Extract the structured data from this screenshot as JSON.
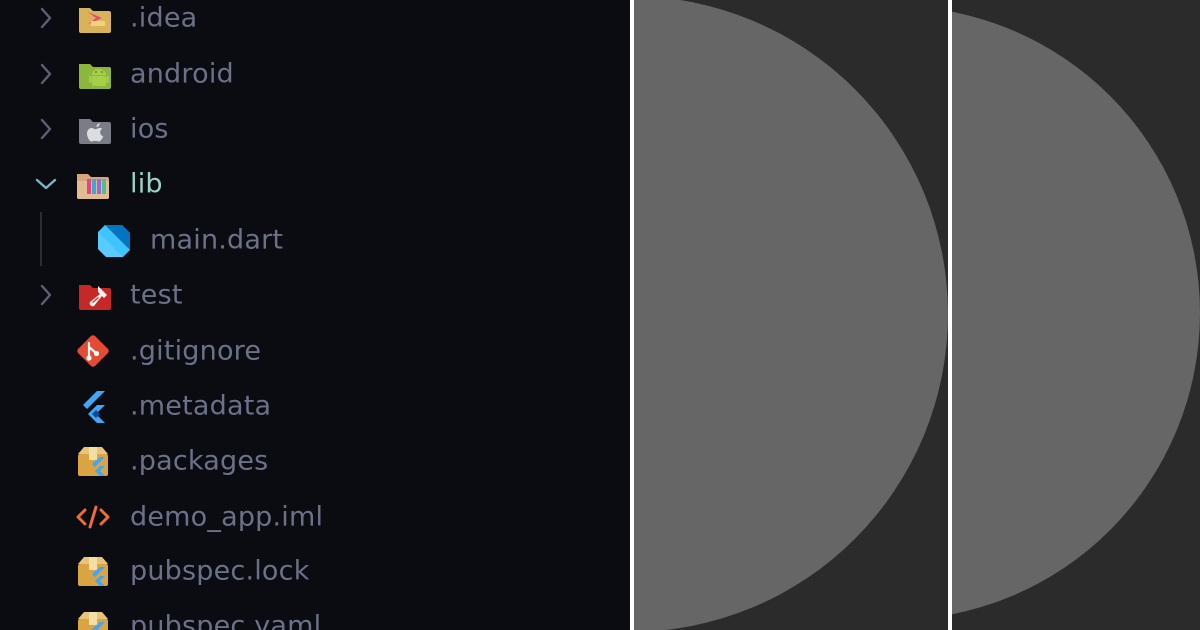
{
  "explorer": {
    "items": [
      {
        "name": ".idea",
        "type": "folder",
        "expanded": false,
        "icon": "idea-folder-icon"
      },
      {
        "name": "android",
        "type": "folder",
        "expanded": false,
        "icon": "android-folder-icon"
      },
      {
        "name": "ios",
        "type": "folder",
        "expanded": false,
        "icon": "apple-folder-icon"
      },
      {
        "name": "lib",
        "type": "folder",
        "expanded": true,
        "icon": "lib-folder-icon"
      },
      {
        "name": "main.dart",
        "type": "file",
        "icon": "dart-file-icon"
      },
      {
        "name": "test",
        "type": "folder",
        "expanded": false,
        "icon": "test-folder-icon"
      },
      {
        "name": ".gitignore",
        "type": "file",
        "icon": "git-icon"
      },
      {
        "name": ".metadata",
        "type": "file",
        "icon": "flutter-icon"
      },
      {
        "name": ".packages",
        "type": "file",
        "icon": "package-icon"
      },
      {
        "name": "demo_app.iml",
        "type": "file",
        "icon": "xml-code-icon"
      },
      {
        "name": "pubspec.lock",
        "type": "file",
        "icon": "package-icon"
      },
      {
        "name": "pubspec.yaml",
        "type": "file",
        "icon": "package-icon"
      }
    ]
  },
  "colors": {
    "explorer_bg": "#0b0c12",
    "label": "#6b7188",
    "label_open": "#9ad3c4",
    "chevron": "#5b6075",
    "chevron_open": "#7fb3c5",
    "decor_bg": "#2b2b2b",
    "disc": "#666666",
    "divider": "#ffffff"
  }
}
